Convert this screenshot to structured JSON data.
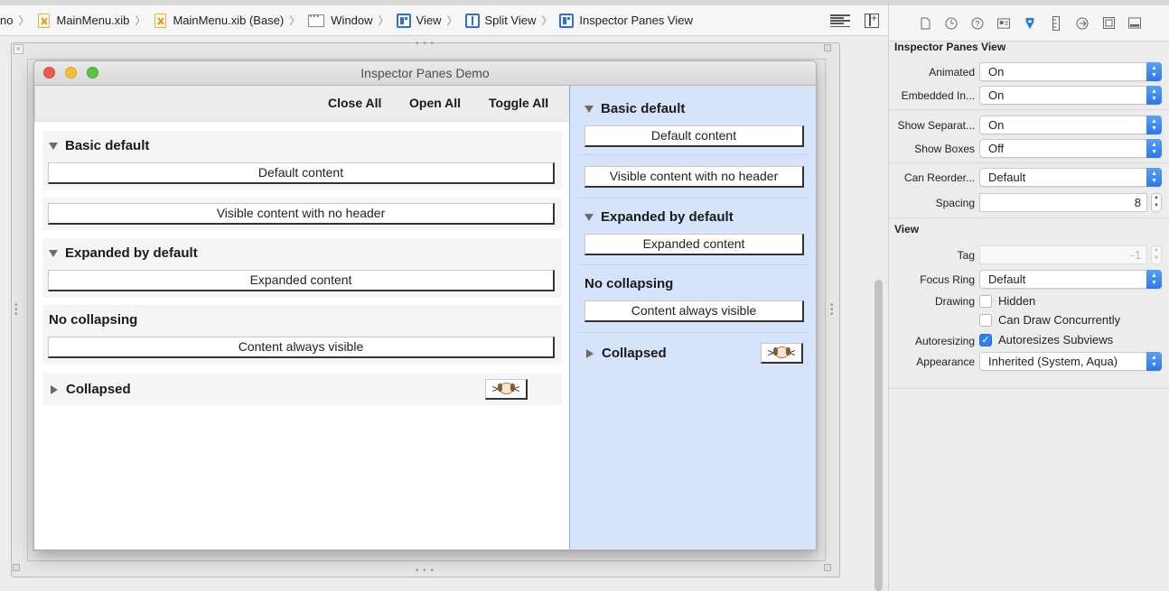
{
  "breadcrumb": {
    "items": [
      {
        "label": "no",
        "icon": "none"
      },
      {
        "label": "MainMenu.xib",
        "icon": "xib-file-icon"
      },
      {
        "label": "MainMenu.xib (Base)",
        "icon": "xib-file-icon"
      },
      {
        "label": "Window",
        "icon": "window-icon"
      },
      {
        "label": "View",
        "icon": "view-icon"
      },
      {
        "label": "Split View",
        "icon": "split-view-icon"
      },
      {
        "label": "Inspector Panes View",
        "icon": "view-icon"
      }
    ]
  },
  "demo": {
    "title": "Inspector Panes Demo",
    "toolbar": {
      "close_all": "Close All",
      "open_all": "Open All",
      "toggle_all": "Toggle All"
    },
    "left": {
      "basic_title": "Basic default",
      "basic_content": "Default content",
      "noheader_content": "Visible content with no header",
      "expanded_title": "Expanded by default",
      "expanded_content": "Expanded content",
      "nocollapse_title": "No collapsing",
      "nocollapse_content": "Content always visible",
      "collapsed_title": "Collapsed",
      "emoji_left": ">",
      "emoji_right": "<"
    },
    "right": {
      "basic_title": "Basic default",
      "basic_content": "Default content",
      "noheader_content": "Visible content with no header",
      "expanded_title": "Expanded by default",
      "expanded_content": "Expanded content",
      "nocollapse_title": "No collapsing",
      "nocollapse_content": "Content always visible",
      "collapsed_title": "Collapsed",
      "emoji_left": ">",
      "emoji_right": "<"
    }
  },
  "inspector": {
    "section1_title": "Inspector Panes View",
    "animated_label": "Animated",
    "animated_value": "On",
    "embedded_label": "Embedded In...",
    "embedded_value": "On",
    "separators_label": "Show Separat...",
    "separators_value": "On",
    "boxes_label": "Show Boxes",
    "boxes_value": "Off",
    "reorder_label": "Can Reorder...",
    "reorder_value": "Default",
    "spacing_label": "Spacing",
    "spacing_value": "8",
    "section2_title": "View",
    "tag_label": "Tag",
    "tag_value": "-1",
    "focus_label": "Focus Ring",
    "focus_value": "Default",
    "drawing_label": "Drawing",
    "hidden_label": "Hidden",
    "concurrent_label": "Can Draw Concurrently",
    "autoresizing_label": "Autoresizing",
    "autoresizes_label": "Autoresizes Subviews",
    "appearance_label": "Appearance",
    "appearance_value": "Inherited (System, Aqua)"
  },
  "colors": {
    "accent": "#2b77e8",
    "right_pane_bg": "#d6e4fb",
    "close_light": "#ee5a51",
    "min_light": "#f6bd3b",
    "max_light": "#5cc445"
  }
}
